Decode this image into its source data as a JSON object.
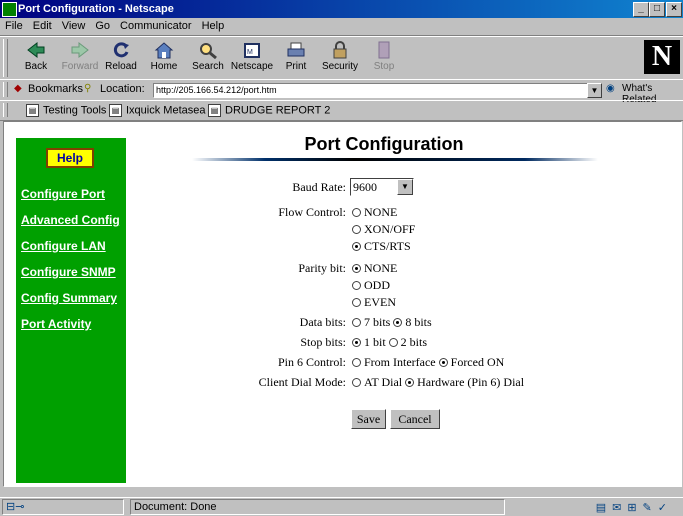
{
  "window": {
    "title": "Port Configuration - Netscape",
    "buttons": [
      "_",
      "□",
      "×"
    ]
  },
  "menu": [
    "File",
    "Edit",
    "View",
    "Go",
    "Communicator",
    "Help"
  ],
  "toolbar": {
    "back": "Back",
    "forward": "Forward",
    "reload": "Reload",
    "home": "Home",
    "search": "Search",
    "netscape": "Netscape",
    "print": "Print",
    "security": "Security",
    "stop": "Stop",
    "logo": "N"
  },
  "location": {
    "bookmarks": "Bookmarks",
    "label": "Location:",
    "url": "http://205.166.54.212/port.htm",
    "related": "What's Related"
  },
  "personal_toolbar": [
    "Testing Tools -",
    "Ixquick Metasea",
    "DRUDGE REPORT 2"
  ],
  "sidebar": {
    "help": "Help",
    "links": [
      "Configure Port",
      "Advanced Config",
      "Configure LAN",
      "Configure SNMP",
      "Config Summary",
      "Port Activity"
    ]
  },
  "page": {
    "title": "Port Configuration",
    "baud": {
      "label": "Baud Rate:",
      "value": "9600"
    },
    "flow": {
      "label": "Flow Control:",
      "options": [
        "NONE",
        "XON/OFF",
        "CTS/RTS"
      ],
      "selected": "CTS/RTS"
    },
    "parity": {
      "label": "Parity bit:",
      "options": [
        "NONE",
        "ODD",
        "EVEN"
      ],
      "selected": "NONE"
    },
    "data_bits": {
      "label": "Data bits:",
      "options": [
        "7 bits",
        "8 bits"
      ],
      "selected": "8 bits"
    },
    "stop_bits": {
      "label": "Stop bits:",
      "options": [
        "1 bit",
        "2 bits"
      ],
      "selected": "1 bit"
    },
    "pin6": {
      "label": "Pin 6 Control:",
      "options": [
        "From Interface",
        "Forced ON"
      ],
      "selected": "Forced ON"
    },
    "dial": {
      "label": "Client Dial Mode:",
      "options": [
        "AT Dial",
        "Hardware (Pin 6) Dial"
      ],
      "selected": "Hardware (Pin 6) Dial"
    },
    "save": "Save",
    "cancel": "Cancel"
  },
  "status": {
    "text": "Document: Done"
  }
}
